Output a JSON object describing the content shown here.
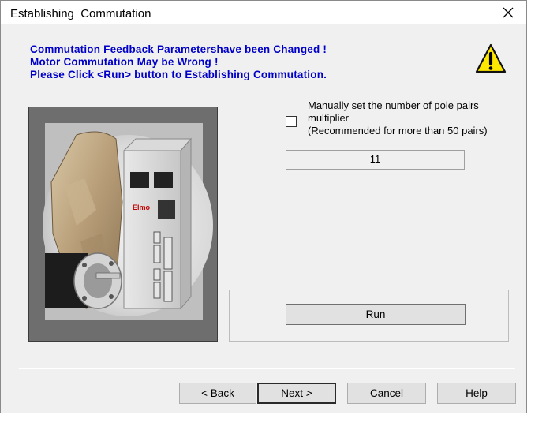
{
  "window": {
    "title": "Establishing  Commutation",
    "close_icon": "close-x-icon"
  },
  "message": {
    "lines": [
      "Commutation Feedback Parametershave been Changed !",
      "Motor Commutation May be Wrong !",
      "Please Click <Run> button to Establishing Commutation."
    ],
    "color": "#0000c8",
    "icon": "warning-icon"
  },
  "illustration": {
    "brand": "Elmo",
    "description_icon": "motor-drive-illustration"
  },
  "pole_pairs": {
    "checkbox_label_line1": "Manually set the number of pole pairs",
    "checkbox_label_line2": "multiplier",
    "checkbox_label_line3": "(Recommended for more than 50 pairs)",
    "checked": false,
    "value": "11"
  },
  "run_button": {
    "label": "Run"
  },
  "footer": {
    "back_label": "< Back",
    "next_label": "Next >",
    "cancel_label": "Cancel",
    "help_label": "Help"
  }
}
